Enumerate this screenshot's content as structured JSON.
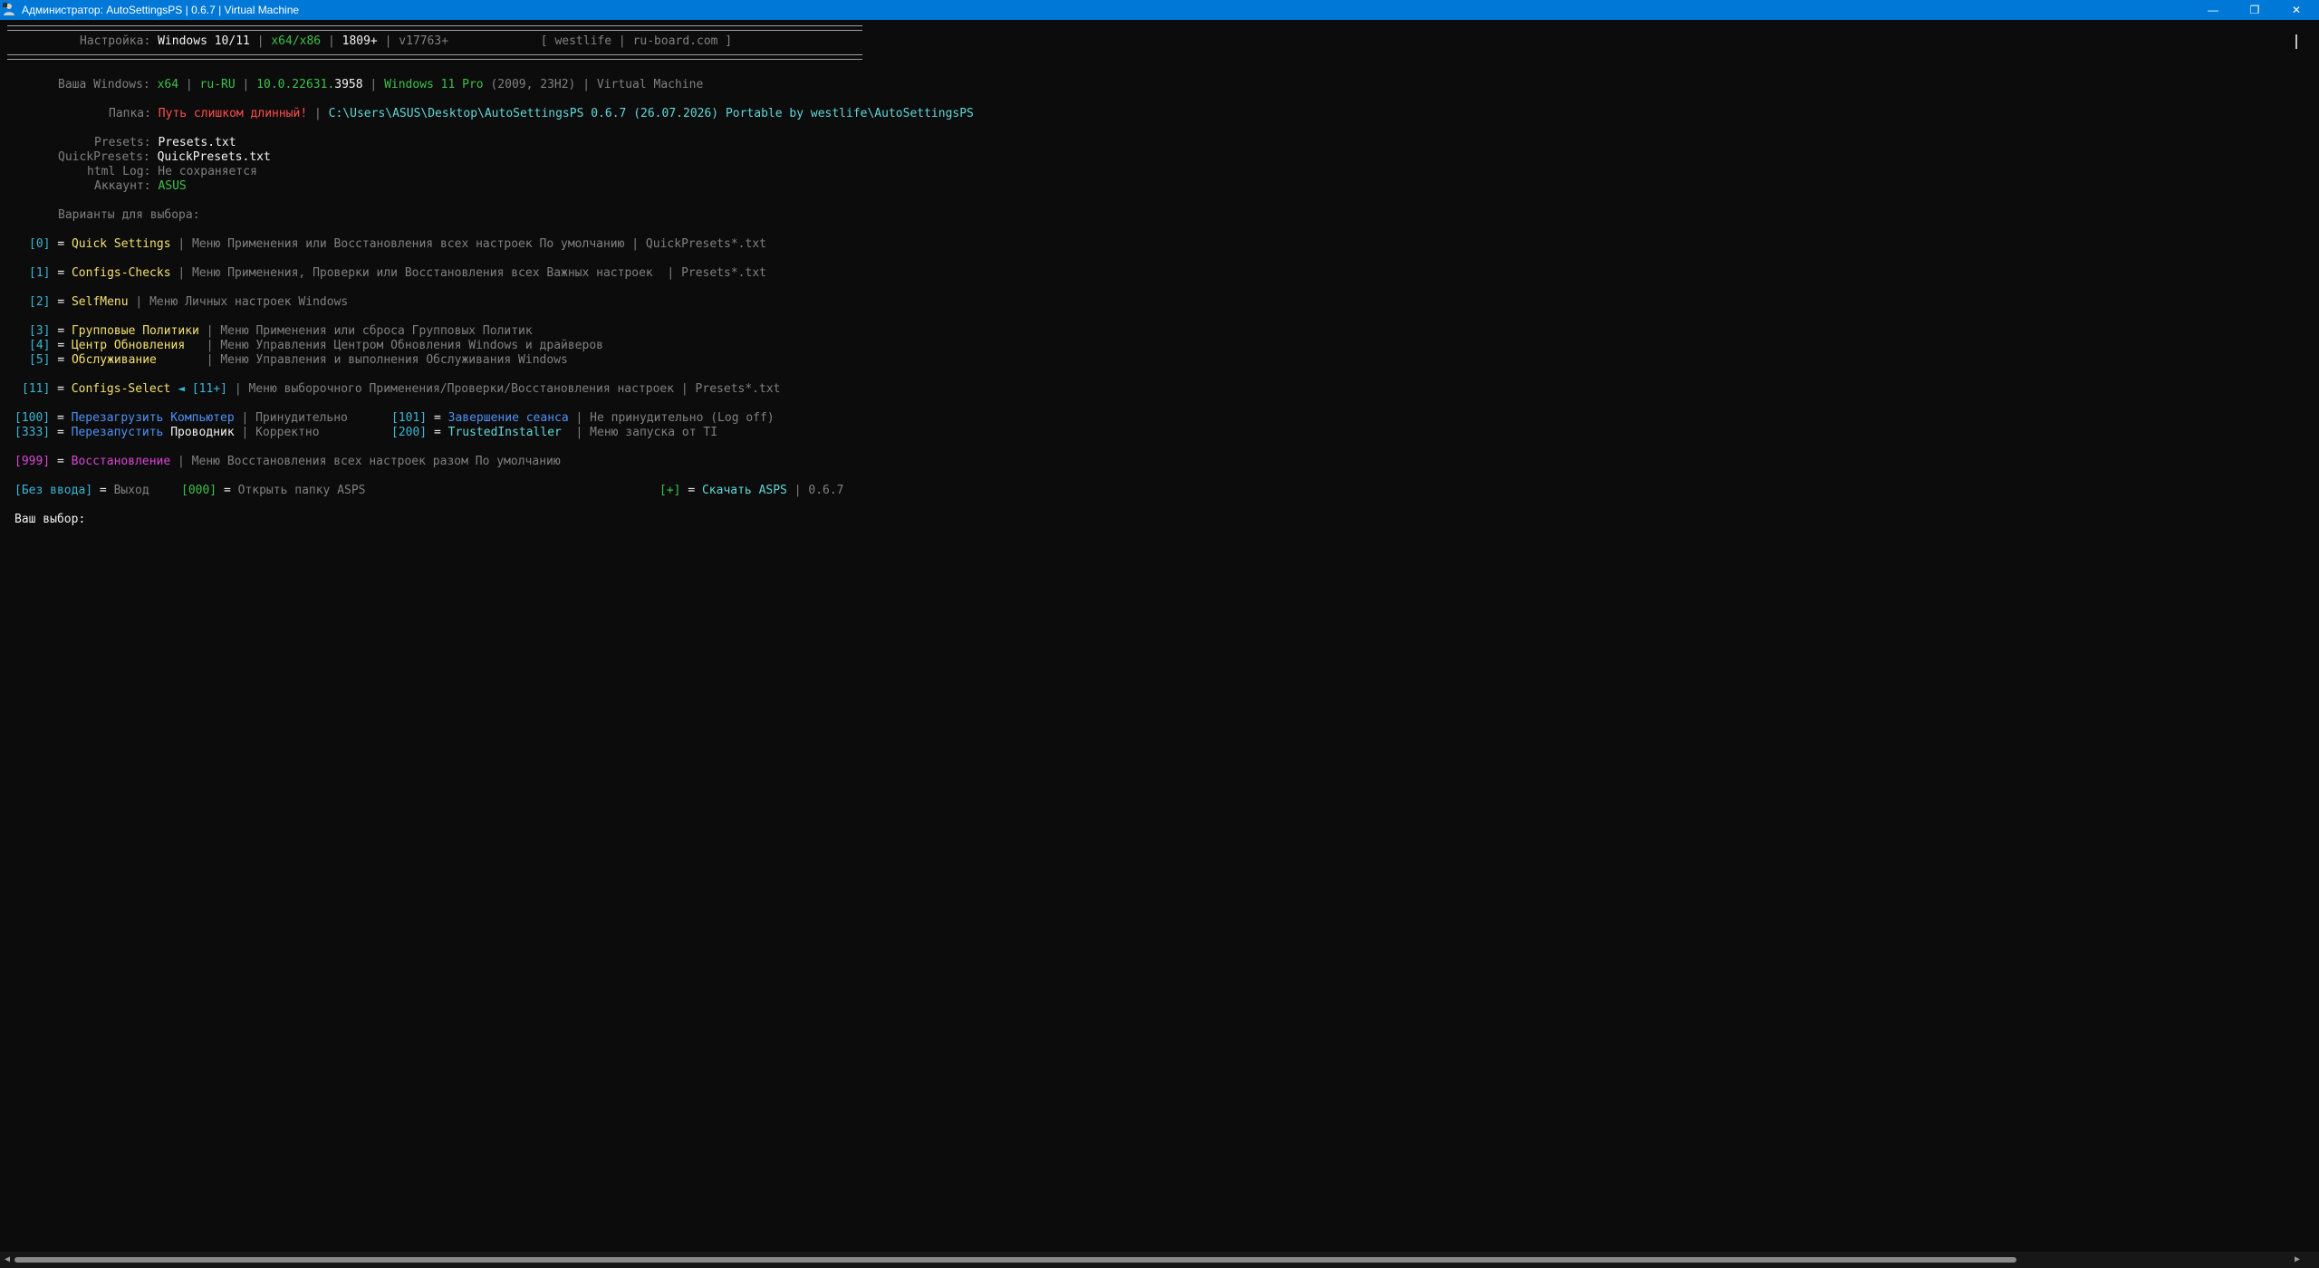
{
  "window": {
    "title": "Администратор: AutoSettingsPS | 0.6.7 | Virtual Machine",
    "minimize_glyph": "—",
    "maximize_glyph": "❐",
    "close_glyph": "✕"
  },
  "header": {
    "settings_label": "Настройка:",
    "os": "Windows 10/11",
    "sep": "|",
    "arch": "x64/x86",
    "build_min": "1809+",
    "version_min": "v17763+",
    "author_open": "[ westlife",
    "site": "ru-board.com ]"
  },
  "system": {
    "your_windows_label": "Ваша Windows:",
    "arch": "x64",
    "locale": "ru-RU",
    "build": "10.0.22631.",
    "build_rev": "3958",
    "edition": "Windows 11 Pro",
    "release": "(2009, 23H2)",
    "machine": "Virtual Machine",
    "folder_label": "Папка:",
    "folder_warning": "Путь слишком длинный!",
    "folder_path": "C:\\Users\\ASUS\\Desktop\\AutoSettingsPS 0.6.7 (26.07.2026) Portable by westlife\\AutoSettingsPS",
    "presets_label": "Presets:",
    "presets_file": "Presets.txt",
    "quickpresets_label": "QuickPresets:",
    "quickpresets_file": "QuickPresets.txt",
    "htmllog_label": "html Log:",
    "htmllog_value": "Не сохраняется",
    "account_label": "Аккаунт:",
    "account_value": "ASUS"
  },
  "menu": {
    "options_label": "Варианты для выбора:",
    "items": [
      {
        "key": "[0]",
        "eq": "=",
        "name": "Quick Settings",
        "desc": "| Меню Применения или Восстановления всех настроек По умолчанию | QuickPresets*.txt"
      },
      {
        "key": "[1]",
        "eq": "=",
        "name": "Configs-Checks",
        "desc": "| Меню Применения, Проверки или Восстановления всех Важных настроек  | Presets*.txt"
      },
      {
        "key": "[2]",
        "eq": "=",
        "name": "SelfMenu",
        "desc": "| Меню Личных настроек Windows"
      },
      {
        "key": "[3]",
        "eq": "=",
        "name": "Групповые Политики",
        "desc": "| Меню Применения или сброса Групповых Политик"
      },
      {
        "key": "[4]",
        "eq": "=",
        "name": "Центр Обновления",
        "desc": "| Меню Управления Центром Обновления Windows и драйверов"
      },
      {
        "key": "[5]",
        "eq": "=",
        "name": "Обслуживание",
        "desc": "| Меню Управления и выполнения Обслуживания Windows"
      },
      {
        "key": "[11]",
        "eq": "=",
        "name": "Configs-Select",
        "arrow": "◄ [11+]",
        "desc": "| Меню выборочного Применения/Проверки/Восстановления настроек | Presets*.txt"
      }
    ],
    "restart_pc": {
      "key": "[100]",
      "eq": "=",
      "name_a": "Перезагрузить",
      "name_b": "Компьютер",
      "desc": "| Принудительно"
    },
    "logoff": {
      "key": "[101]",
      "eq": "=",
      "name": "Завершение сеанса",
      "desc": "| Не принудительно (Log off)"
    },
    "restart_explorer": {
      "key": "[333]",
      "eq": "=",
      "name_a": "Перезапустить",
      "name_b": "Проводник",
      "desc": "| Корректно"
    },
    "trusted": {
      "key": "[200]",
      "eq": "=",
      "name": "TrustedInstaller",
      "desc": "| Меню запуска от TI"
    },
    "restore": {
      "key": "[999]",
      "eq": "=",
      "name": "Восстановление",
      "desc": "| Меню Восстановления всех настроек разом По умолчанию"
    },
    "no_input": {
      "key": "[Без ввода]",
      "eq": "=",
      "desc": "Выход"
    },
    "open_folder": {
      "key": "[000]",
      "eq": "=",
      "desc": "Открыть папку ASPS"
    },
    "download": {
      "key": "[+]",
      "eq": "=",
      "name": "Скачать ASPS",
      "desc": "| 0.6.7"
    },
    "prompt": "Ваш выбор:"
  },
  "colors": {
    "title_bar": "#0078d7",
    "background": "#0c0c0c",
    "gray": "#808080",
    "white": "#f2f2f2",
    "green": "#3bc14a",
    "cyan": "#3ab6d4",
    "yellow": "#f4e06d",
    "red": "#ff4d4d",
    "magenta": "#d946d4",
    "blue": "#4f8ff7"
  },
  "scrollbar": {
    "left_arrow": "◀",
    "right_arrow": "▶"
  }
}
